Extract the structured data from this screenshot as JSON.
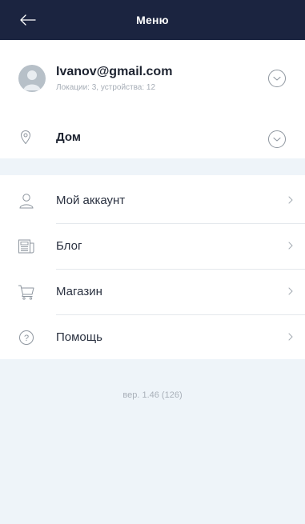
{
  "header": {
    "title": "Меню",
    "back_icon": "arrow-left-icon"
  },
  "account": {
    "email": "Ivanov@gmail.com",
    "summary": "Локации: 3, устройства: 12",
    "avatar_icon": "user-avatar-icon",
    "expand_icon": "chevron-down-circle-icon"
  },
  "location": {
    "name": "Дом",
    "icon": "location-pin-icon",
    "expand_icon": "chevron-down-circle-icon"
  },
  "menu": {
    "items": [
      {
        "label": "Мой аккаунт",
        "icon": "user-icon"
      },
      {
        "label": "Блог",
        "icon": "newspaper-icon"
      },
      {
        "label": "Магазин",
        "icon": "cart-icon"
      },
      {
        "label": "Помощь",
        "icon": "help-circle-icon"
      }
    ]
  },
  "footer": {
    "version": "вер. 1.46 (126)"
  },
  "colors": {
    "header_bg": "#1b2440",
    "page_bg": "#eef4f9",
    "text_primary": "#1d2330",
    "text_secondary": "#a6adb6"
  }
}
